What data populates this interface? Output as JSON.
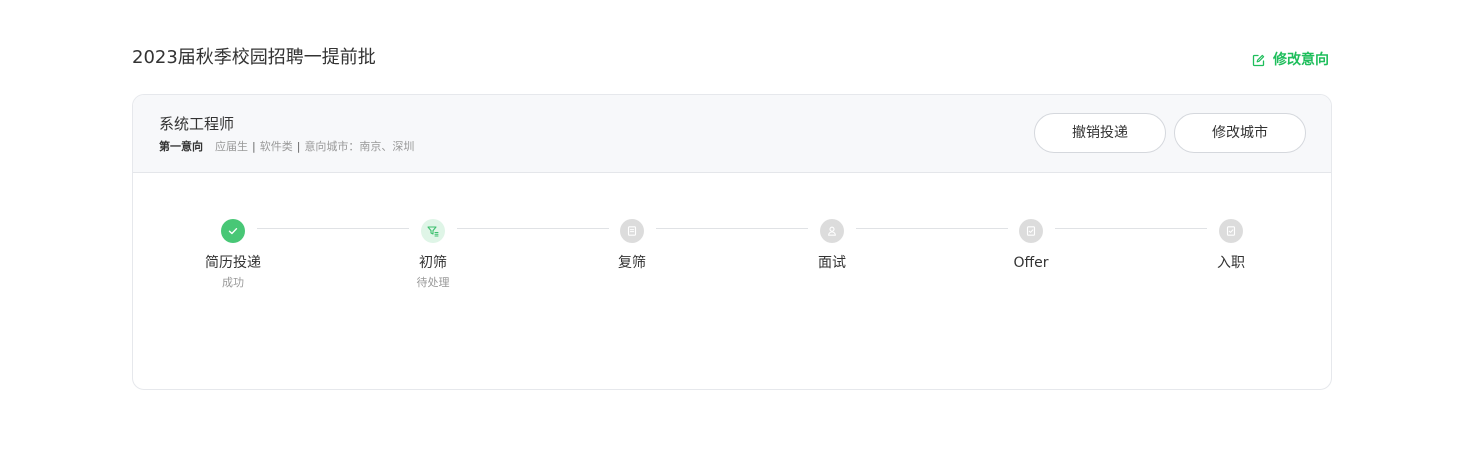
{
  "header": {
    "title": "2023届秋季校园招聘一提前批",
    "modify_intent_label": "修改意向"
  },
  "application": {
    "job_title": "系统工程师",
    "priority": "第一意向",
    "meta": {
      "candidate_type": "应届生",
      "category": "软件类",
      "cities_label": "意向城市：南京、深圳"
    },
    "separator": "|",
    "actions": {
      "withdraw_label": "撤销投递",
      "change_city_label": "修改城市"
    }
  },
  "progress": {
    "steps": [
      {
        "label": "简历投递",
        "status": "成功",
        "state": "done",
        "icon": "check-icon"
      },
      {
        "label": "初筛",
        "status": "待处理",
        "state": "current",
        "icon": "filter-icon"
      },
      {
        "label": "复筛",
        "status": "",
        "state": "pending",
        "icon": "document-icon"
      },
      {
        "label": "面试",
        "status": "",
        "state": "pending",
        "icon": "person-icon"
      },
      {
        "label": "Offer",
        "status": "",
        "state": "pending",
        "icon": "offer-icon"
      },
      {
        "label": "入职",
        "status": "",
        "state": "pending",
        "icon": "onboard-icon"
      }
    ]
  },
  "colors": {
    "accent_green": "#1fbe5c",
    "done_green": "#48c776",
    "current_bg": "#dff5e7",
    "pending_gray": "#dcdcdc"
  }
}
